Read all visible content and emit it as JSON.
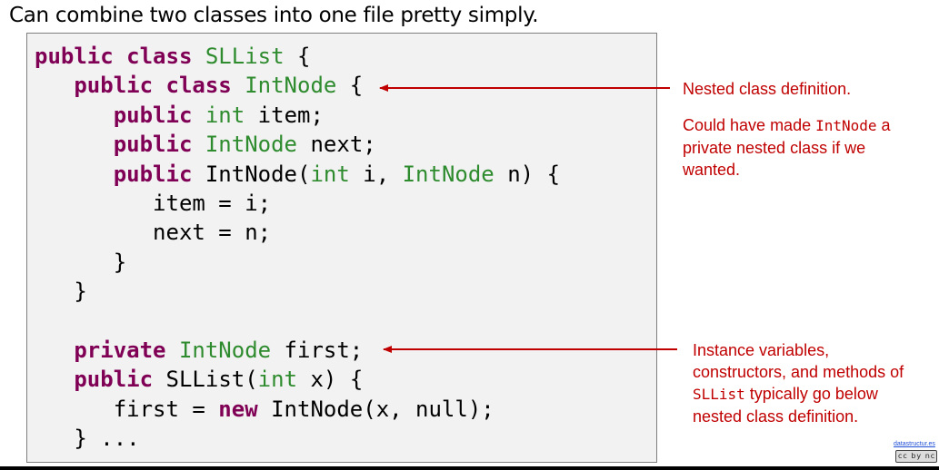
{
  "title": "Can combine two classes into one file pretty simply.",
  "code": {
    "lines": [
      [
        {
          "t": "public class ",
          "c": "kw"
        },
        {
          "t": "SLList",
          "c": "ty"
        },
        {
          "t": " {",
          "c": ""
        }
      ],
      [
        {
          "t": "   ",
          "c": ""
        },
        {
          "t": "public class ",
          "c": "kw"
        },
        {
          "t": "IntNode",
          "c": "ty"
        },
        {
          "t": " {",
          "c": ""
        }
      ],
      [
        {
          "t": "      ",
          "c": ""
        },
        {
          "t": "public ",
          "c": "kw"
        },
        {
          "t": "int",
          "c": "ty"
        },
        {
          "t": " item;",
          "c": ""
        }
      ],
      [
        {
          "t": "      ",
          "c": ""
        },
        {
          "t": "public ",
          "c": "kw"
        },
        {
          "t": "IntNode",
          "c": "ty"
        },
        {
          "t": " next;",
          "c": ""
        }
      ],
      [
        {
          "t": "      ",
          "c": ""
        },
        {
          "t": "public ",
          "c": "kw"
        },
        {
          "t": "IntNode(",
          "c": ""
        },
        {
          "t": "int",
          "c": "ty"
        },
        {
          "t": " i, ",
          "c": ""
        },
        {
          "t": "IntNode",
          "c": "ty"
        },
        {
          "t": " n) {",
          "c": ""
        }
      ],
      [
        {
          "t": "         item = i;",
          "c": ""
        }
      ],
      [
        {
          "t": "         next = n;",
          "c": ""
        }
      ],
      [
        {
          "t": "      }",
          "c": ""
        }
      ],
      [
        {
          "t": "   }",
          "c": ""
        }
      ],
      [
        {
          "t": "",
          "c": ""
        }
      ],
      [
        {
          "t": "   ",
          "c": ""
        },
        {
          "t": "private ",
          "c": "kw"
        },
        {
          "t": "IntNode",
          "c": "ty"
        },
        {
          "t": " first;",
          "c": ""
        }
      ],
      [
        {
          "t": "   ",
          "c": ""
        },
        {
          "t": "public ",
          "c": "kw"
        },
        {
          "t": "SLList(",
          "c": ""
        },
        {
          "t": "int",
          "c": "ty"
        },
        {
          "t": " x) {",
          "c": ""
        }
      ],
      [
        {
          "t": "      first = ",
          "c": ""
        },
        {
          "t": "new ",
          "c": "kw"
        },
        {
          "t": "IntNode(x, null);",
          "c": ""
        }
      ],
      [
        {
          "t": "   } ...",
          "c": ""
        }
      ]
    ]
  },
  "annotations": {
    "nested": {
      "line1": "Nested class definition.",
      "line2_pre": "Could have made ",
      "line2_code": "IntNode",
      "line2_post": " a",
      "line3": "private nested class if we",
      "line4": "wanted."
    },
    "instance": {
      "line1": "Instance variables,",
      "line2": "constructors, and methods of",
      "line3_code": "SLList",
      "line3_post": " typically go below",
      "line4": "nested class definition."
    }
  },
  "footer": {
    "source_link": "datastructur.es",
    "license_badge": "cc by nc sa"
  },
  "colors": {
    "keyword": "#7f0055",
    "type": "#2e8b2e",
    "annotation": "#c00000",
    "code_background": "#f2f2f2"
  }
}
